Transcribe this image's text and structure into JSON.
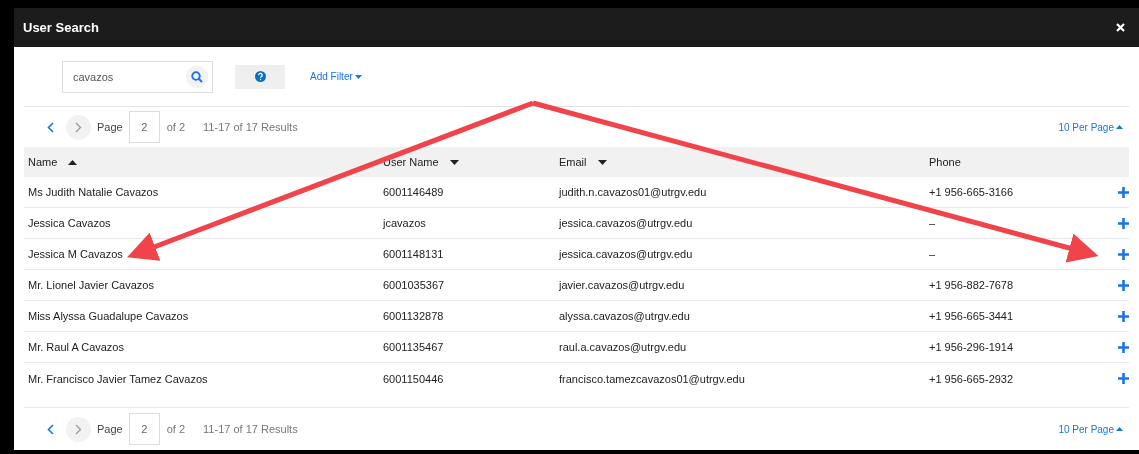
{
  "window": {
    "title": "User Search"
  },
  "search": {
    "value": "cavazos"
  },
  "add_filter": "Add Filter",
  "pagination_top": {
    "page_label": "Page",
    "page": "2",
    "of": "of 2",
    "results": "11-17 of 17 Results",
    "per_page": "10 Per Page"
  },
  "table": {
    "columns": [
      {
        "label": "Name",
        "sort_up": true,
        "sort_down": false
      },
      {
        "label": "User Name",
        "sort_up": false,
        "sort_down": true
      },
      {
        "label": "Email",
        "sort_up": false,
        "sort_down": true
      },
      {
        "label": "Phone",
        "sort_up": false,
        "sort_down": false
      }
    ],
    "rows": [
      [
        "Ms Judith Natalie Cavazos",
        "6001146489",
        "judith.n.cavazos01@utrgv.edu",
        "+1 956-665-3166"
      ],
      [
        "Jessica Cavazos",
        "jcavazos",
        "jessica.cavazos@utrgv.edu",
        "–"
      ],
      [
        "Jessica M Cavazos",
        "6001148131",
        "jessica.cavazos@utrgv.edu",
        "–"
      ],
      [
        "Mr. Lionel Javier Cavazos",
        "6001035367",
        "javier.cavazos@utrgv.edu",
        "+1 956-882-7678"
      ],
      [
        "Miss Alyssa Guadalupe Cavazos",
        "6001132878",
        "alyssa.cavazos@utrgv.edu",
        "+1 956-665-3441"
      ],
      [
        "Mr. Raul A Cavazos",
        "6001135467",
        "raul.a.cavazos@utrgv.edu",
        "+1 956-296-1914"
      ],
      [
        "Mr. Francisco Javier Tamez Cavazos",
        "6001150446",
        "francisco.tamezcavazos01@utrgv.edu",
        "+1 956-665-2932"
      ]
    ]
  },
  "pagination_bottom": {
    "page_label": "Page",
    "page": "2",
    "of": "of 2",
    "results": "11-17 of 17 Results",
    "per_page": "10 Per Page"
  }
}
